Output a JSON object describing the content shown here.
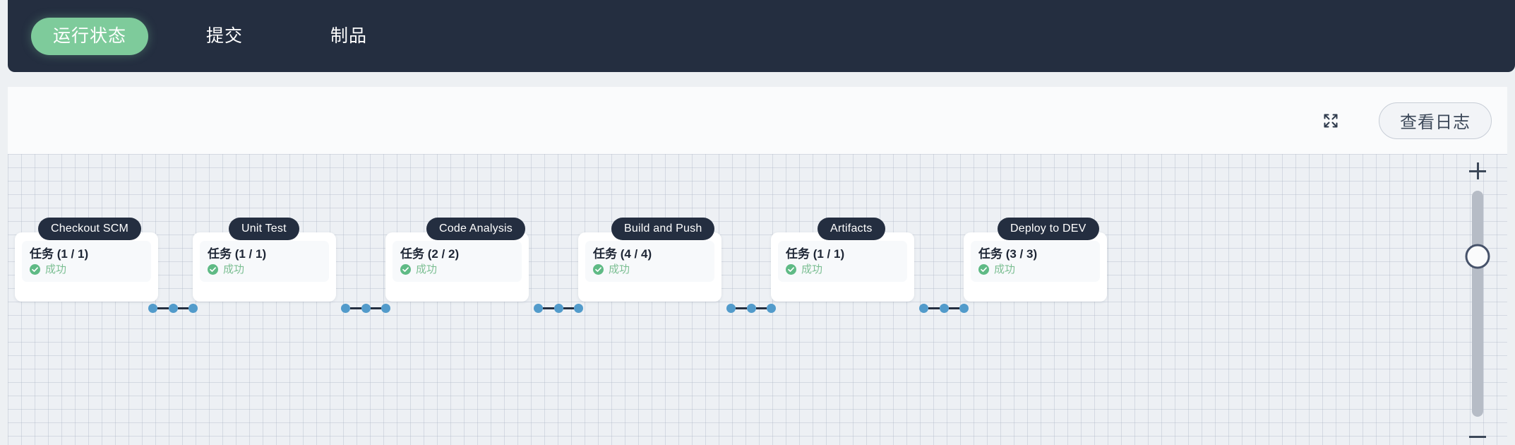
{
  "nav": {
    "tabs": [
      {
        "label": "运行状态",
        "active": true
      },
      {
        "label": "提交",
        "active": false
      },
      {
        "label": "制品",
        "active": false
      }
    ],
    "active_color": "#7ecb9b",
    "bar_color": "#242e40"
  },
  "toolbar": {
    "expand_icon": "expand-arrows-icon",
    "log_button_label": "查看日志"
  },
  "canvas": {
    "grid": true,
    "grid_size_px": 19,
    "background_color": "#edf0f4",
    "stages": [
      {
        "label": "Checkout SCM",
        "task": "任务 (1 / 1)",
        "status": "成功",
        "status_icon": "check-circle-icon"
      },
      {
        "label": "Unit Test",
        "task": "任务 (1 / 1)",
        "status": "成功",
        "status_icon": "check-circle-icon"
      },
      {
        "label": "Code Analysis",
        "task": "任务 (2 / 2)",
        "status": "成功",
        "status_icon": "check-circle-icon"
      },
      {
        "label": "Build and Push",
        "task": "任务 (4 / 4)",
        "status": "成功",
        "status_icon": "check-circle-icon"
      },
      {
        "label": "Artifacts",
        "task": "任务 (1 / 1)",
        "status": "成功",
        "status_icon": "check-circle-icon"
      },
      {
        "label": "Deploy to DEV",
        "task": "任务 (3 / 3)",
        "status": "成功",
        "status_icon": "check-circle-icon"
      }
    ],
    "connector_dot_color": "#529bcb",
    "connector_line_color": "#242e40",
    "status_color": "#7cbf93"
  },
  "zoom_control": {
    "plus_label": "+",
    "minus_label": "−",
    "handle_position_percent": 29
  }
}
